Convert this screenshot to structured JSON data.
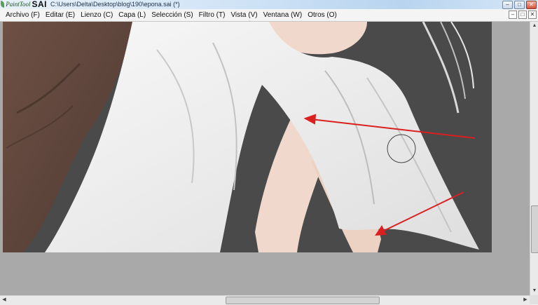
{
  "app": {
    "logo_text": "PaintTool",
    "logo_brand": "SAI",
    "window_title": "C:\\Users\\Delta\\Desktop\\blog\\190\\epona.sai (*)"
  },
  "window_buttons": {
    "minimize": "–",
    "maximize": "□",
    "close": "✕"
  },
  "menu": {
    "items": [
      {
        "label": "Archivo (F)"
      },
      {
        "label": "Editar (E)"
      },
      {
        "label": "Lienzo (C)"
      },
      {
        "label": "Capa (L)"
      },
      {
        "label": "Selección (S)"
      },
      {
        "label": "Filtro (T)"
      },
      {
        "label": "Vista (V)"
      },
      {
        "label": "Ventana (W)"
      },
      {
        "label": "Otros (O)"
      }
    ]
  },
  "mdi_buttons": {
    "minimize": "–",
    "restore": "□",
    "close": "✕"
  },
  "scrollbars": {
    "vertical": {
      "up": "▲",
      "down": "▼"
    },
    "horizontal": {
      "left": "◀",
      "right": "▶"
    }
  },
  "colors": {
    "canvas_background": "#4a4a4a",
    "workspace": "#a9a9a9",
    "annotation_arrow": "#d9201f",
    "cloth": "#f2f2f2",
    "skin": "#f0d9cc",
    "hair_dark": "#7a5b4d"
  }
}
